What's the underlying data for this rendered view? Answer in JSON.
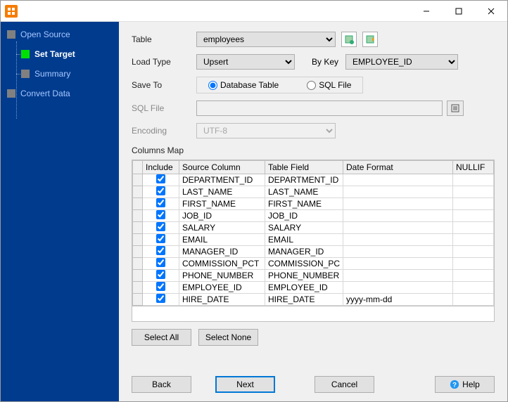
{
  "titlebar": {
    "min": "—",
    "max": "▢",
    "close": "✕"
  },
  "sidebar": {
    "items": [
      {
        "label": "Open Source"
      },
      {
        "label": "Set Target"
      },
      {
        "label": "Summary"
      },
      {
        "label": "Convert Data"
      }
    ]
  },
  "form": {
    "table_label": "Table",
    "table_value": "employees",
    "loadtype_label": "Load Type",
    "loadtype_value": "Upsert",
    "bykey_label": "By Key",
    "bykey_value": "EMPLOYEE_ID",
    "saveto_label": "Save To",
    "saveto_db": "Database Table",
    "saveto_sql": "SQL File",
    "sqlfile_label": "SQL File",
    "sqlfile_value": "",
    "encoding_label": "Encoding",
    "encoding_value": "UTF-8",
    "columns_map_label": "Columns Map"
  },
  "grid": {
    "headers": {
      "include": "Include",
      "source": "Source Column",
      "field": "Table Field",
      "datefmt": "Date Format",
      "nullif": "NULLIF"
    },
    "rows": [
      {
        "include": true,
        "source": "DEPARTMENT_ID",
        "field": "DEPARTMENT_ID",
        "datefmt": "",
        "nullif": ""
      },
      {
        "include": true,
        "source": "LAST_NAME",
        "field": "LAST_NAME",
        "datefmt": "",
        "nullif": ""
      },
      {
        "include": true,
        "source": "FIRST_NAME",
        "field": "FIRST_NAME",
        "datefmt": "",
        "nullif": ""
      },
      {
        "include": true,
        "source": "JOB_ID",
        "field": "JOB_ID",
        "datefmt": "",
        "nullif": ""
      },
      {
        "include": true,
        "source": "SALARY",
        "field": "SALARY",
        "datefmt": "",
        "nullif": ""
      },
      {
        "include": true,
        "source": "EMAIL",
        "field": "EMAIL",
        "datefmt": "",
        "nullif": ""
      },
      {
        "include": true,
        "source": "MANAGER_ID",
        "field": "MANAGER_ID",
        "datefmt": "",
        "nullif": ""
      },
      {
        "include": true,
        "source": "COMMISSION_PCT",
        "field": "COMMISSION_PC",
        "datefmt": "",
        "nullif": ""
      },
      {
        "include": true,
        "source": "PHONE_NUMBER",
        "field": "PHONE_NUMBER",
        "datefmt": "",
        "nullif": ""
      },
      {
        "include": true,
        "source": "EMPLOYEE_ID",
        "field": "EMPLOYEE_ID",
        "datefmt": "",
        "nullif": ""
      },
      {
        "include": true,
        "source": "HIRE_DATE",
        "field": "HIRE_DATE",
        "datefmt": "yyyy-mm-dd",
        "nullif": ""
      }
    ]
  },
  "buttons": {
    "select_all": "Select All",
    "select_none": "Select None",
    "back": "Back",
    "next": "Next",
    "cancel": "Cancel",
    "help": "Help"
  }
}
